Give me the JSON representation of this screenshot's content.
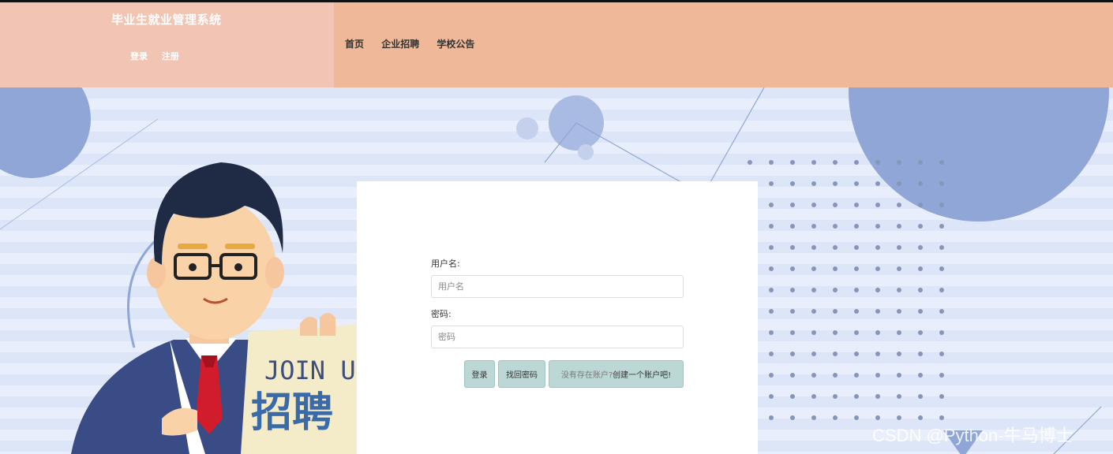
{
  "app": {
    "title": "毕业生就业管理系统",
    "auth": {
      "login": "登录",
      "register": "注册"
    }
  },
  "nav": {
    "items": [
      "首页",
      "企业招聘",
      "学校公告"
    ]
  },
  "hero": {
    "banner_text": "JOIN US",
    "banner_text_cn": "招聘"
  },
  "login_form": {
    "username_label": "用户名:",
    "username_placeholder": "用户名",
    "password_label": "密码:",
    "password_placeholder": "密码",
    "login_button": "登录",
    "recover_button": "找回密码",
    "register_prompt_muted": "没有存在账户?",
    "register_prompt_link": "创建一个账户吧!"
  },
  "watermark": "CSDN @Python-牛马博士",
  "colors": {
    "header_left": "#f2c4b3",
    "header_right": "#efb899",
    "button": "#bcd8d6"
  }
}
